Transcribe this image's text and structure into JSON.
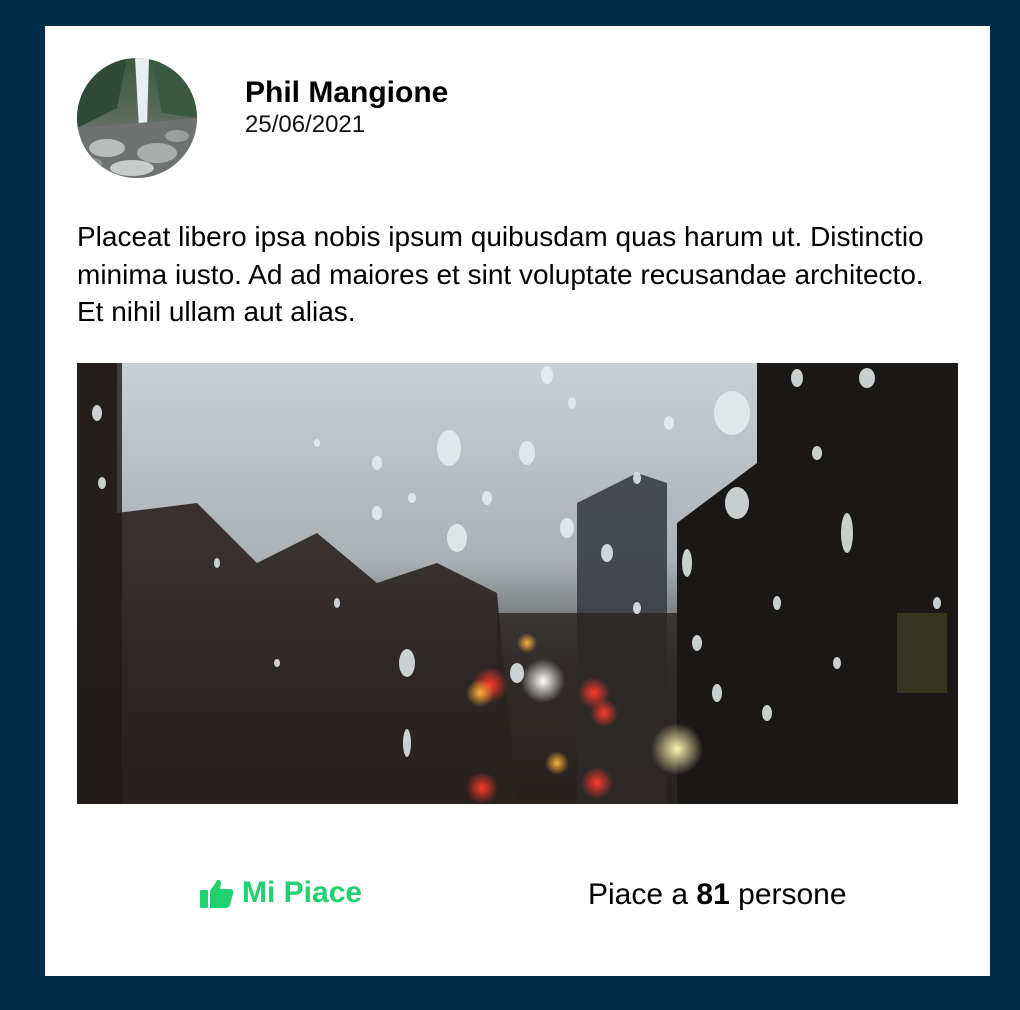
{
  "post": {
    "author": {
      "name": "Phil Mangione",
      "avatar_icon": "avatar-waterfall-photo"
    },
    "date": "25/06/2021",
    "text": "Placeat libero ipsa nobis ipsum quibusdam quas harum ut. Distinctio minima iusto. Ad ad maiores et sint voluptate recusandae architecto. Et nihil ullam aut alias.",
    "image": {
      "description_icon": "rainy-window-city-photo"
    },
    "footer": {
      "like_label": "Mi Piace",
      "like_icon": "thumbs-up-icon",
      "like_color": "#1fd16f",
      "likes_prefix": "Piace a",
      "likes_count": "81",
      "likes_suffix": "persone"
    }
  },
  "colors": {
    "page_background": "#002d47",
    "card_background": "#ffffff"
  }
}
